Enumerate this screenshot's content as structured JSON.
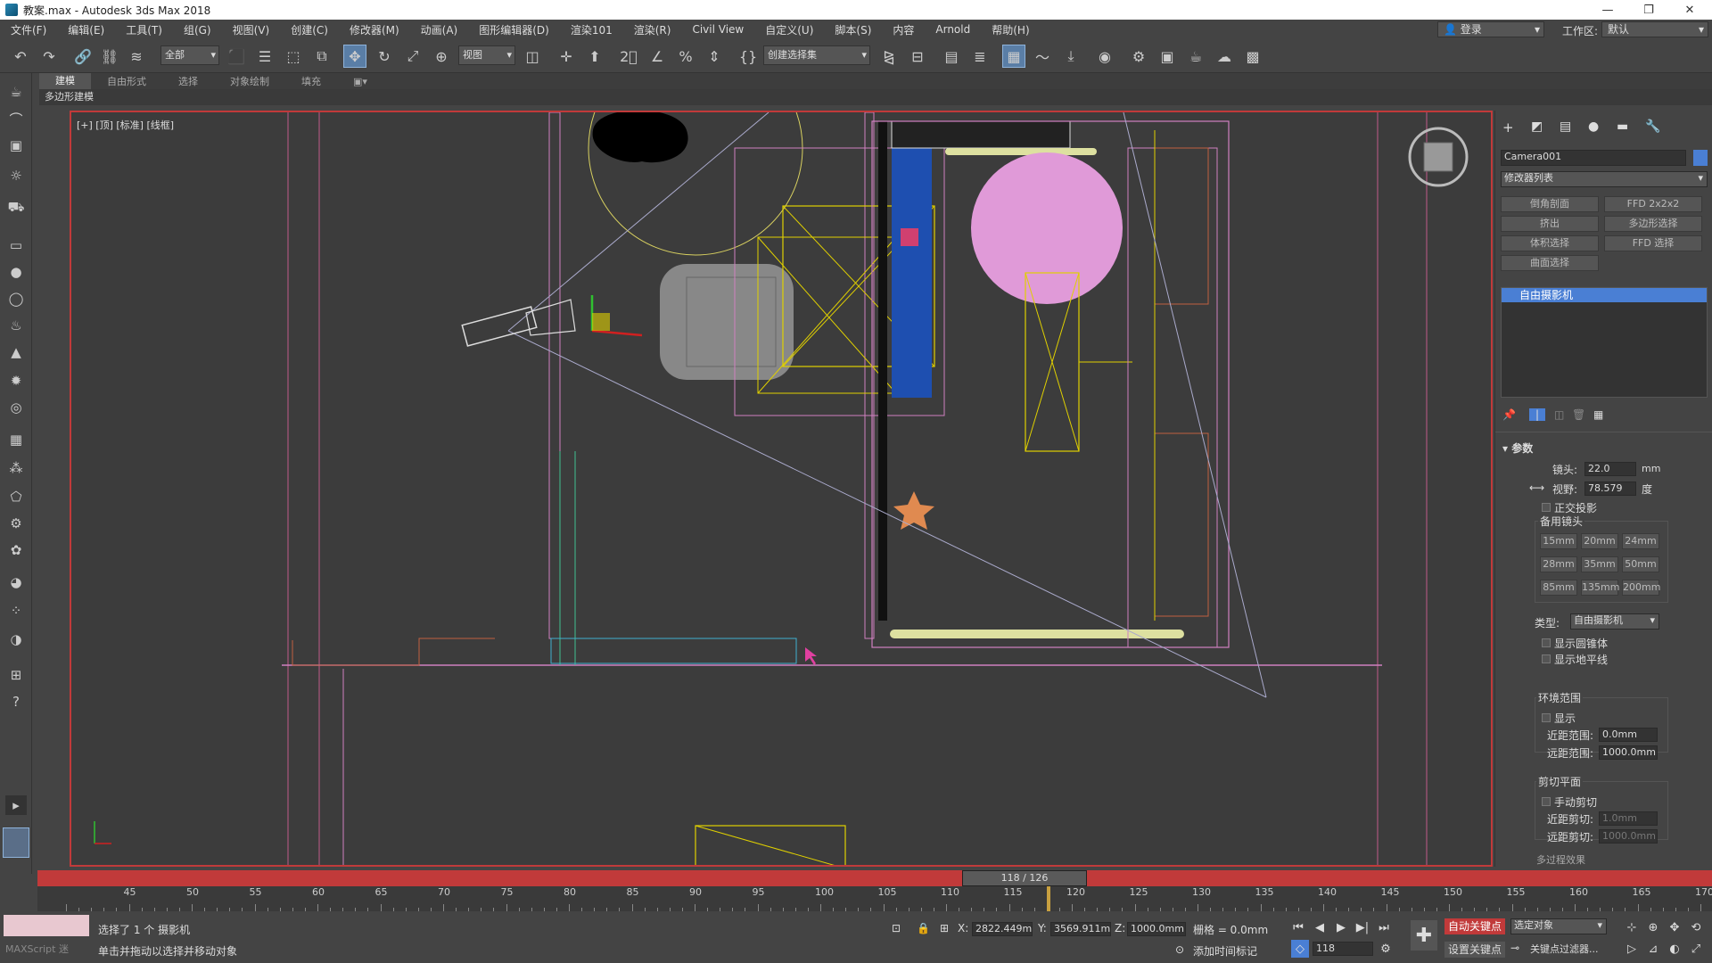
{
  "window": {
    "title": "教案.max - Autodesk 3ds Max 2018",
    "minimize": "—",
    "restore": "❐",
    "close": "✕"
  },
  "menu": [
    "文件(F)",
    "编辑(E)",
    "工具(T)",
    "组(G)",
    "视图(V)",
    "创建(C)",
    "修改器(M)",
    "动画(A)",
    "图形编辑器(D)",
    "渲染101",
    "渲染(R)",
    "Civil View",
    "自定义(U)",
    "脚本(S)",
    "内容",
    "Arnold",
    "帮助(H)"
  ],
  "login": {
    "label": "登录"
  },
  "workspace": {
    "label": "工作区:",
    "value": "默认"
  },
  "toolbar": {
    "selection_filter": "全部",
    "coord_system": "视图",
    "named_selection": "创建选择集"
  },
  "ribbon": {
    "tabs": [
      "建模",
      "自由形式",
      "选择",
      "对象绘制",
      "填充"
    ],
    "active": 0,
    "sub_label": "多边形建模"
  },
  "viewport": {
    "label": "[+] [顶] [标准] [线框]"
  },
  "command_panel": {
    "object_name": "Camera001",
    "object_color": "#4a7fd4",
    "modifier_list": "修改器列表",
    "modifier_buttons": [
      "倒角剖面",
      "FFD 2x2x2",
      "挤出",
      "多边形选择",
      "体积选择",
      "FFD 选择",
      "曲面选择"
    ],
    "stack_item": "自由摄影机",
    "rollout_title": "参数",
    "lens_label": "镜头:",
    "lens_value": "22.0",
    "lens_unit": "mm",
    "fov_label": "视野:",
    "fov_value": "78.579",
    "fov_unit": "度",
    "ortho_label": "正交投影",
    "stock_lens_label": "备用镜头",
    "stock_lenses": [
      "15mm",
      "20mm",
      "24mm",
      "28mm",
      "35mm",
      "50mm",
      "85mm",
      "135mm",
      "200mm"
    ],
    "type_label": "类型:",
    "type_value": "自由摄影机",
    "show_cone": "显示圆锥体",
    "show_horizon": "显示地平线",
    "env_range_label": "环境范围",
    "env_show": "显示",
    "near_range_label": "近距范围:",
    "near_range_value": "0.0mm",
    "far_range_label": "远距范围:",
    "far_range_value": "1000.0mm",
    "clip_label": "剪切平面",
    "manual_clip": "手动剪切",
    "near_clip_label": "近距剪切:",
    "near_clip_value": "1.0mm",
    "far_clip_label": "远距剪切:",
    "far_clip_value": "1000.0mm",
    "more_label": "多过程效果"
  },
  "timeline": {
    "current": "118 / 126",
    "current_frame": 118,
    "ticks": [
      "45",
      "50",
      "55",
      "60",
      "65",
      "70",
      "75",
      "80",
      "85",
      "90",
      "95",
      "100",
      "105",
      "110",
      "115",
      "120",
      "125",
      "130",
      "135",
      "140",
      "145",
      "150",
      "155",
      "160",
      "165",
      "170"
    ]
  },
  "status": {
    "selection": "选择了 1 个 摄影机",
    "prompt": "单击并拖动以选择并移动对象",
    "maxscript": "MAXScript 迷",
    "x_label": "X:",
    "x_value": "2822.449m",
    "y_label": "Y:",
    "y_value": "3569.911m",
    "z_label": "Z:",
    "z_value": "1000.0mm",
    "grid_label": "栅格 = 0.0mm",
    "add_time_tag": "添加时间标记",
    "auto_key": "自动关键点",
    "set_key": "设置关键点",
    "selected_obj": "选定对象",
    "key_filters": "关键点过滤器...",
    "frame_field": "118"
  }
}
